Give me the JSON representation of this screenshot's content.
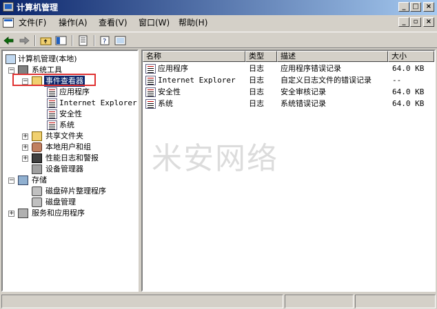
{
  "window": {
    "title": "计算机管理"
  },
  "menu": [
    "文件(F)",
    "操作(A)",
    "查看(V)",
    "窗口(W)",
    "帮助(H)"
  ],
  "tree": {
    "root": "计算机管理(本地)",
    "system_tools": "系统工具",
    "event_viewer": "事件查看器",
    "event_logs": [
      "应用程序",
      "Internet Explorer",
      "安全性",
      "系统"
    ],
    "shared_folders": "共享文件夹",
    "local_users": "本地用户和组",
    "perf_logs": "性能日志和警报",
    "device_manager": "设备管理器",
    "storage": "存储",
    "defrag": "磁盘碎片整理程序",
    "disk_mgmt": "磁盘管理",
    "services": "服务和应用程序"
  },
  "list": {
    "columns": [
      "名称",
      "类型",
      "描述",
      "大小"
    ],
    "rows": [
      {
        "name": "应用程序",
        "type": "日志",
        "desc": "应用程序错误记录",
        "size": "64.0 KB"
      },
      {
        "name": "Internet Explorer",
        "type": "日志",
        "desc": "自定义日志文件的错误记录",
        "size": "--"
      },
      {
        "name": "安全性",
        "type": "日志",
        "desc": "安全审核记录",
        "size": "64.0 KB"
      },
      {
        "name": "系统",
        "type": "日志",
        "desc": "系统错误记录",
        "size": "64.0 KB"
      }
    ]
  },
  "watermark": "米安网络",
  "colors": {
    "titlebar": "#0a246a",
    "selection": "#0a246a",
    "highlight_box": "#e03030"
  }
}
